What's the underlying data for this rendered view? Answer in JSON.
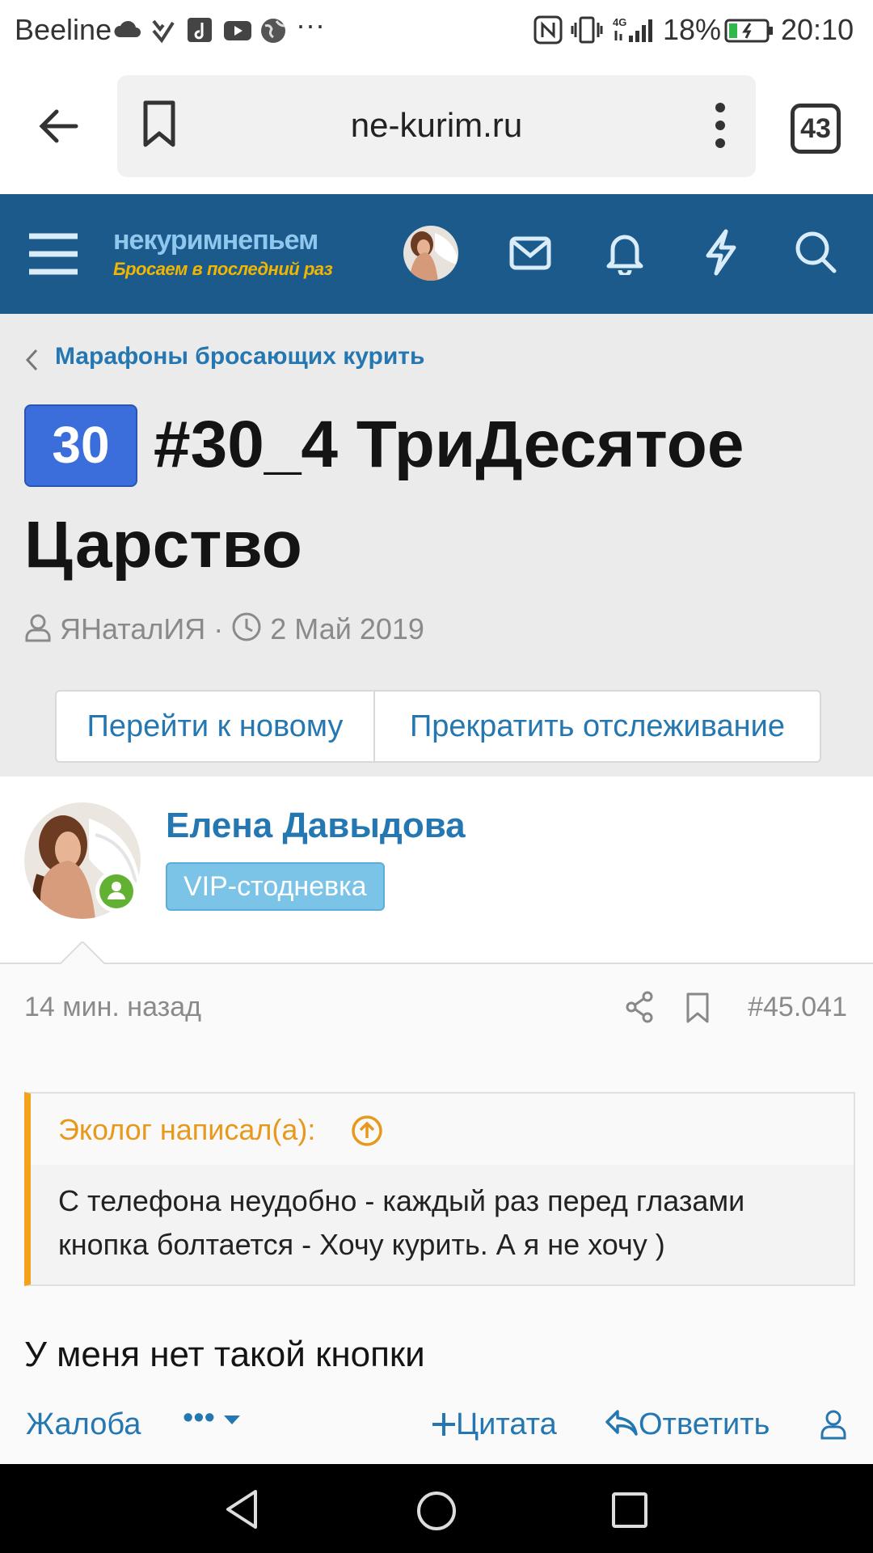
{
  "status_bar": {
    "carrier": "Beeline",
    "battery": "18%",
    "time": "20:10",
    "more": "···"
  },
  "browser": {
    "url": "ne-kurim.ru",
    "tab_count": "43"
  },
  "site": {
    "logo_top": "некуримнепьем",
    "logo_bottom": "Бросаем в последний раз",
    "header_color": "#1b5a8a"
  },
  "thread": {
    "breadcrumb": "Марафоны бросающих курить",
    "prefix": "30",
    "title": "#30_4 ТриДесятое Царство",
    "author": "ЯНаталИЯ",
    "separator": "·",
    "date": "2 Май 2019",
    "btn_new": "Перейти к новому",
    "btn_unwatch": "Прекратить отслеживание"
  },
  "post": {
    "username": "Елена Давыдова",
    "user_title": "VIP-стодневка",
    "time": "14 мин. назад",
    "number": "#45.041",
    "quote_author": "Эколог написал(а):",
    "quote_text": "С телефона неудобно - каждый раз перед глазами кнопка болтается - Хочу курить. А я не хочу )",
    "body": "У меня нет такой кнопки",
    "actions": {
      "report": "Жалоба",
      "more": "•••",
      "quote": "Цитата",
      "reply": "Ответить"
    }
  }
}
